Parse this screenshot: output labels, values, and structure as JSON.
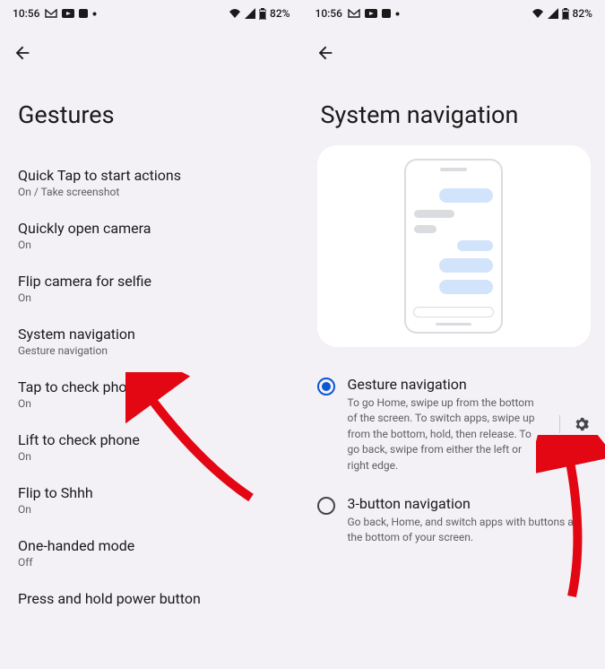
{
  "status": {
    "time": "10:56",
    "battery": "82%"
  },
  "screen1": {
    "title": "Gestures",
    "items": [
      {
        "title": "Quick Tap to start actions",
        "sub": "On / Take screenshot"
      },
      {
        "title": "Quickly open camera",
        "sub": "On"
      },
      {
        "title": "Flip camera for selfie",
        "sub": "On"
      },
      {
        "title": "System navigation",
        "sub": "Gesture navigation"
      },
      {
        "title": "Tap to check phone",
        "sub": "On"
      },
      {
        "title": "Lift to check phone",
        "sub": "On"
      },
      {
        "title": "Flip to Shhh",
        "sub": "On"
      },
      {
        "title": "One-handed mode",
        "sub": "Off"
      },
      {
        "title": "Press and hold power button",
        "sub": ""
      }
    ]
  },
  "screen2": {
    "title": "System navigation",
    "options": [
      {
        "title": "Gesture navigation",
        "desc": "To go Home, swipe up from the bottom of the screen. To switch apps, swipe up from the bottom, hold, then release. To go back, swipe from either the left or right edge.",
        "selected": true
      },
      {
        "title": "3-button navigation",
        "desc": "Go back, Home, and switch apps with buttons at the bottom of your screen.",
        "selected": false
      }
    ]
  }
}
